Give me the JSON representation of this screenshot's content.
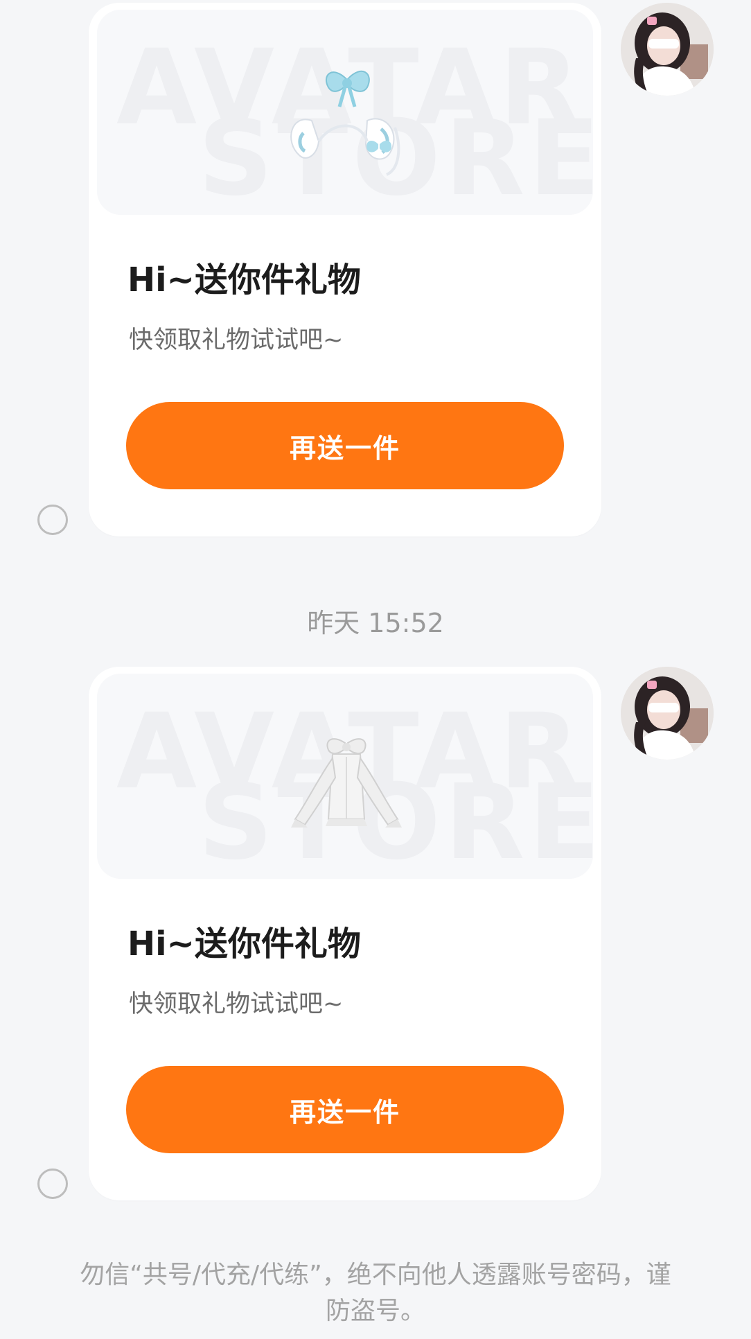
{
  "messages": [
    {
      "title": "Hi~送你件礼物",
      "subtitle": "快领取礼物试试吧~",
      "button_label": "再送一件",
      "watermark_line1": "AVATAR",
      "watermark_line2": "STORE"
    },
    {
      "title": "Hi~送你件礼物",
      "subtitle": "快领取礼物试试吧~",
      "button_label": "再送一件",
      "watermark_line1": "AVATAR",
      "watermark_line2": "STORE"
    }
  ],
  "timestamp": "昨天 15:52",
  "safety_notice": "勿信“共号/代充/代练”，绝不向他人透露账号密码，谨防盗号。",
  "colors": {
    "accent": "#ff7612",
    "background": "#f5f6f8",
    "card": "#ffffff"
  },
  "icons": {
    "gift_1": "blue-bow-bunny-ears",
    "gift_2": "white-bow-dress",
    "avatar": "user-avatar"
  }
}
